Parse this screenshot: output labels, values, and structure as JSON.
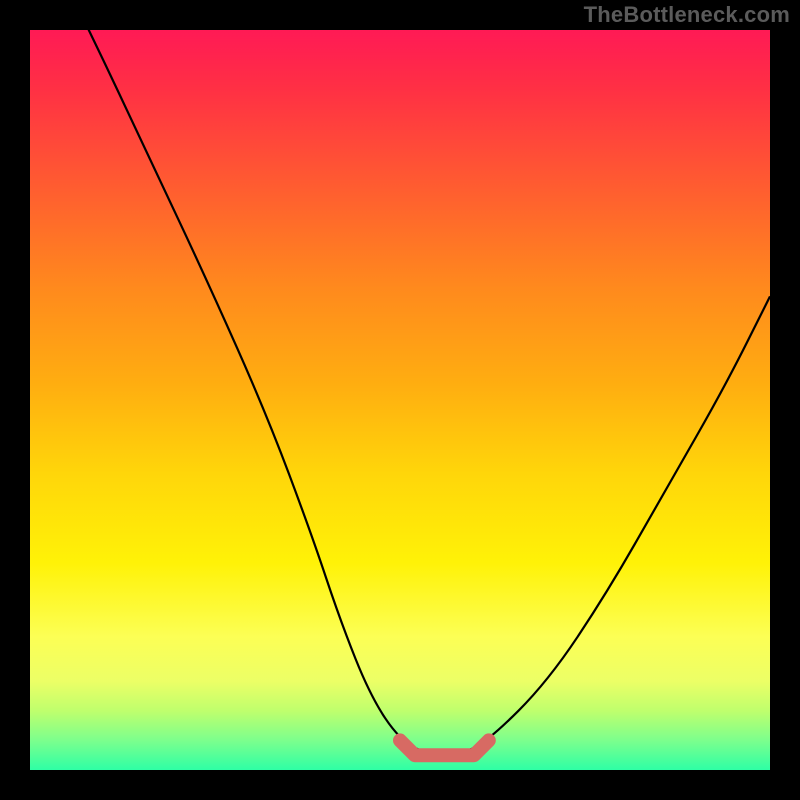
{
  "watermark": "TheBottleneck.com",
  "chart_data": {
    "type": "line",
    "title": "",
    "xlabel": "",
    "ylabel": "",
    "xlim": [
      0,
      100
    ],
    "ylim": [
      0,
      100
    ],
    "series": [
      {
        "name": "bottleneck-percentage-curve",
        "color": "#000000",
        "x": [
          0,
          8,
          16,
          24,
          32,
          38,
          42,
          46,
          50,
          54,
          58,
          62,
          70,
          78,
          86,
          94,
          100
        ],
        "y": [
          116,
          100,
          83,
          66,
          48,
          32,
          20,
          10,
          4,
          2,
          2,
          4,
          12,
          24,
          38,
          52,
          64
        ]
      },
      {
        "name": "optimal-range-marker",
        "color": "#d76a63",
        "x": [
          50,
          52,
          54,
          56,
          58,
          60,
          62
        ],
        "y": [
          4,
          2,
          2,
          2,
          2,
          2,
          4
        ]
      }
    ],
    "annotations": []
  },
  "colors": {
    "background": "#000000",
    "gradient_top": "#ff1a55",
    "gradient_bottom": "#2effa5",
    "curve": "#000000",
    "optimal_marker": "#d76a63",
    "watermark": "#5b5b5b"
  }
}
